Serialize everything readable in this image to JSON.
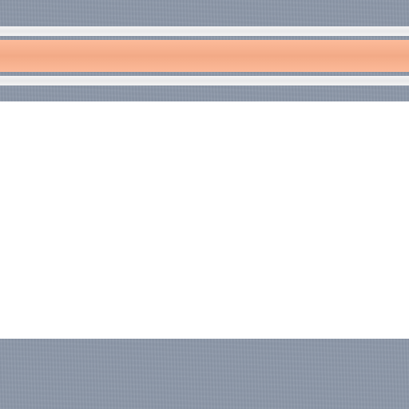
{
  "colors": {
    "slate": "#8c97a8",
    "white_stripe": "#f1f1f2",
    "orange_stripe": "#fcb18c",
    "background": "#ffffff"
  }
}
